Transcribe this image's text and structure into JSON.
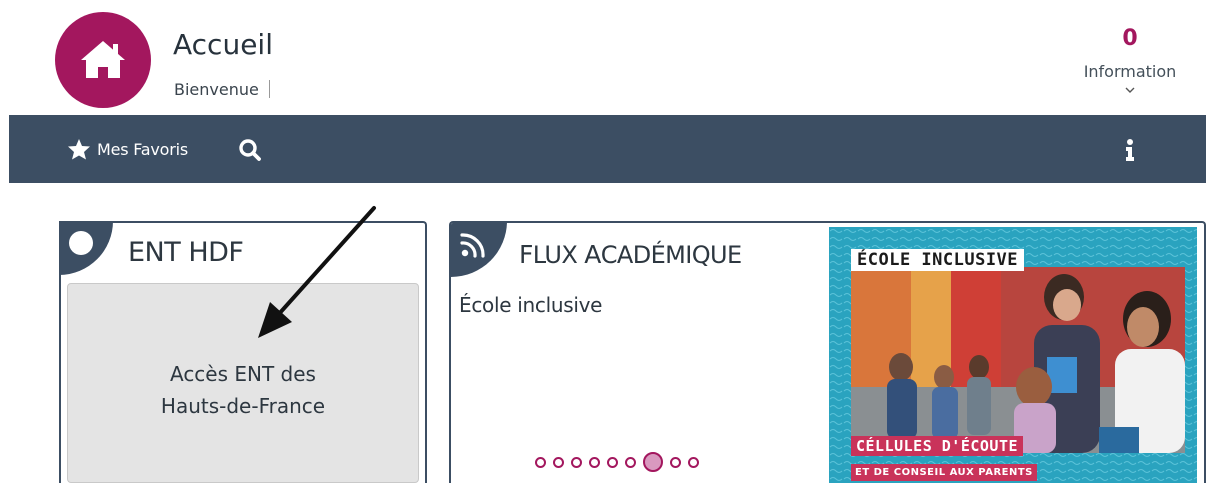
{
  "header": {
    "title": "Accueil",
    "subtitle": "Bienvenue",
    "home_icon": "home-icon",
    "accent_color": "#a3175e"
  },
  "notifications": {
    "count": "0",
    "label": "Information",
    "icon": "chevron-down-icon"
  },
  "navbar": {
    "favorites_label": "Mes Favoris",
    "favorites_icon": "star-icon",
    "search_icon": "search-icon",
    "info_icon": "info-icon",
    "background": "#3c4e63"
  },
  "ent_widget": {
    "title": "ENT HDF",
    "tile_line1": "Accès ENT des",
    "tile_line2": "Hauts-de-France"
  },
  "flux_widget": {
    "title_first": "F",
    "title_rest1": "LUX ",
    "title_a": "A",
    "title_rest2": "CADÉMIQUE",
    "rss_icon": "rss-icon",
    "item_title": "École inclusive",
    "carousel": {
      "total": 9,
      "active_index": 6
    },
    "image": {
      "banner_top": "ÉCOLE INCLUSIVE",
      "banner_mid": "CÉLLULES D'ÉCOUTE",
      "banner_bottom": "ET DE CONSEIL AUX PARENTS"
    }
  }
}
